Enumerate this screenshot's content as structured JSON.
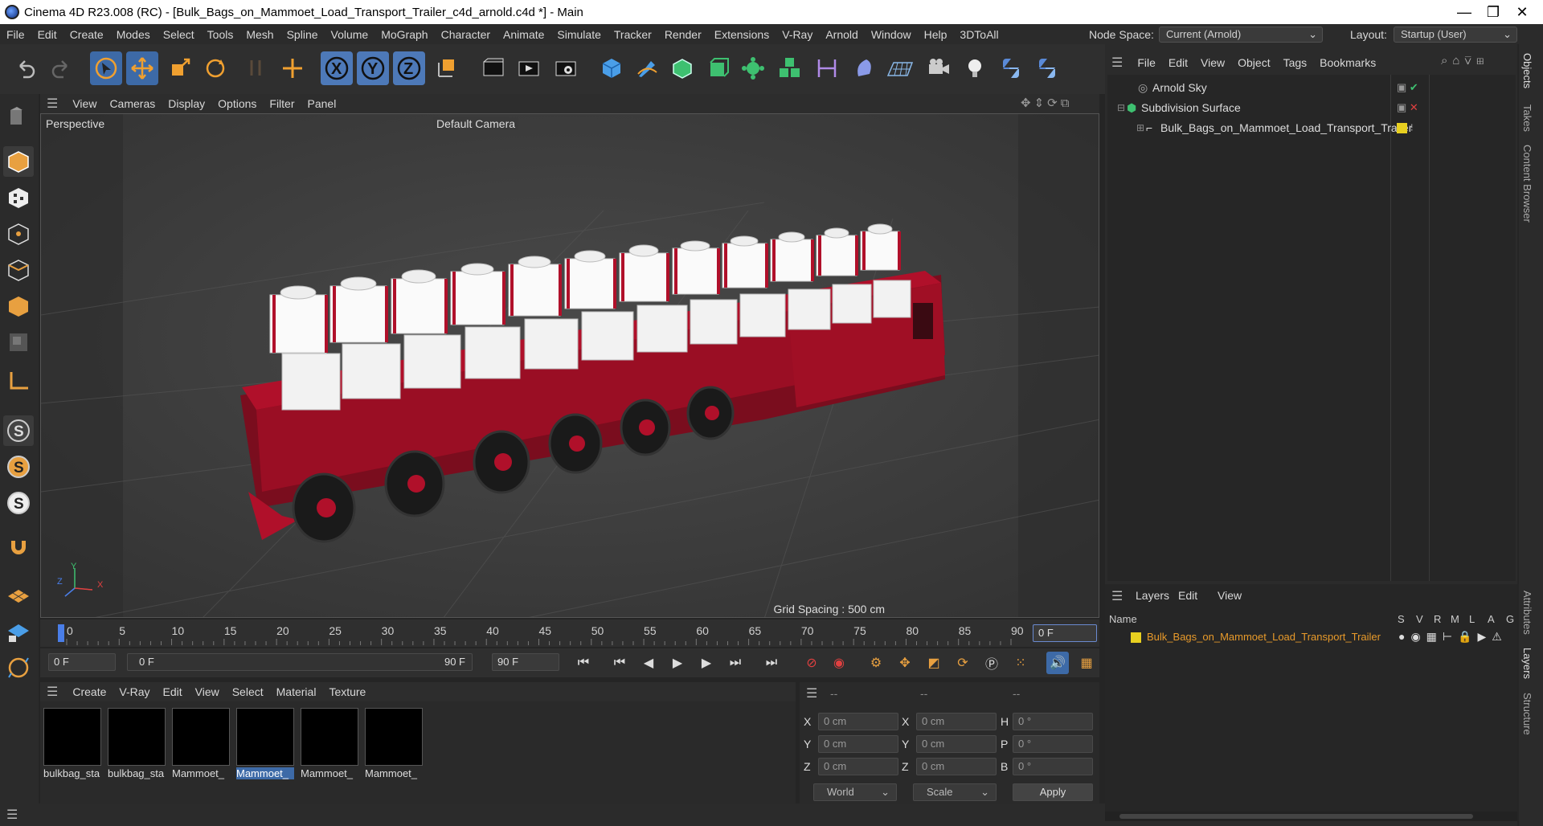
{
  "window": {
    "title": "Cinema 4D R23.008 (RC) - [Bulk_Bags_on_Mammoet_Load_Transport_Trailer_c4d_arnold.c4d *] - Main",
    "minimize": "—",
    "restore": "❐",
    "close": "✕"
  },
  "menu": [
    "File",
    "Edit",
    "Create",
    "Modes",
    "Select",
    "Tools",
    "Mesh",
    "Spline",
    "Volume",
    "MoGraph",
    "Character",
    "Animate",
    "Simulate",
    "Tracker",
    "Render",
    "Extensions",
    "V-Ray",
    "Arnold",
    "Window",
    "Help",
    "3DToAll"
  ],
  "node_space": {
    "label": "Node Space:",
    "value": "Current (Arnold)"
  },
  "layout": {
    "label": "Layout:",
    "value": "Startup (User)"
  },
  "viewport": {
    "menu": [
      "View",
      "Cameras",
      "Display",
      "Options",
      "Filter",
      "Panel"
    ],
    "name": "Perspective",
    "camera": "Default Camera",
    "grid_spacing": "Grid Spacing : 500 cm",
    "axis": {
      "y": "Y",
      "z": "Z",
      "x": "X"
    }
  },
  "timeline": {
    "ticks": [
      "0",
      "5",
      "10",
      "15",
      "20",
      "25",
      "30",
      "35",
      "40",
      "45",
      "50",
      "55",
      "60",
      "65",
      "70",
      "75",
      "80",
      "85",
      "90"
    ],
    "current_frame": "0 F"
  },
  "transport": {
    "start": "0 F",
    "range_start": "0 F",
    "range_end": "90 F",
    "end": "90 F"
  },
  "materials": {
    "menu": [
      "Create",
      "V-Ray",
      "Edit",
      "View",
      "Select",
      "Material",
      "Texture"
    ],
    "items": [
      "bulkbag_sta",
      "bulkbag_sta",
      "Mammoet_",
      "Mammoet_",
      "Mammoet_",
      "Mammoet_"
    ],
    "selected_index": 3
  },
  "coords": {
    "headers": [
      "--",
      "--",
      "--"
    ],
    "rows": [
      {
        "a": "X",
        "av": "0 cm",
        "b": "X",
        "bv": "0 cm",
        "c": "H",
        "cv": "0 °"
      },
      {
        "a": "Y",
        "av": "0 cm",
        "b": "Y",
        "bv": "0 cm",
        "c": "P",
        "cv": "0 °"
      },
      {
        "a": "Z",
        "av": "0 cm",
        "b": "Z",
        "bv": "0 cm",
        "c": "B",
        "cv": "0 °"
      }
    ],
    "space": "World",
    "mode": "Scale",
    "apply": "Apply"
  },
  "objects": {
    "menu": [
      "File",
      "Edit",
      "View",
      "Object",
      "Tags",
      "Bookmarks"
    ],
    "items": [
      {
        "name": "Arnold Sky",
        "status": "check"
      },
      {
        "name": "Subdivision Surface",
        "status": "cross"
      },
      {
        "name": "Bulk_Bags_on_Mammoet_Load_Transport_Trailer",
        "status": "tag"
      }
    ]
  },
  "layers": {
    "menu": [
      "Layers",
      "Edit",
      "View"
    ],
    "columns": [
      "Name",
      "S",
      "V",
      "R",
      "M",
      "L",
      "A",
      "G"
    ],
    "items": [
      {
        "name": "Bulk_Bags_on_Mammoet_Load_Transport_Trailer",
        "color": "#e8d020"
      }
    ]
  },
  "side_tabs": [
    "Objects",
    "Takes",
    "Content Browser",
    "Attributes",
    "Layers",
    "Structure"
  ],
  "colors": {
    "accent": "#3d6aa7",
    "layer_text": "#e89a2a",
    "trailer_red": "#b0102a"
  }
}
